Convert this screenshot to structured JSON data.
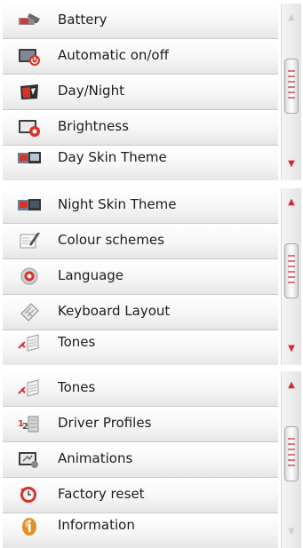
{
  "panels": [
    {
      "items": [
        {
          "label": "Battery",
          "icon": "battery-icon"
        },
        {
          "label": "Automatic on/off",
          "icon": "automatic-power-icon"
        },
        {
          "label": "Day/Night",
          "icon": "day-night-icon"
        },
        {
          "label": "Brightness",
          "icon": "brightness-icon"
        },
        {
          "label": "Day Skin Theme",
          "icon": "day-skin-theme-icon"
        }
      ],
      "scroll": {
        "up_enabled": false,
        "down_enabled": true,
        "up_glyph": "▲",
        "down_glyph": "▼"
      }
    },
    {
      "items": [
        {
          "label": "Night Skin Theme",
          "icon": "night-skin-theme-icon"
        },
        {
          "label": "Colour schemes",
          "icon": "colour-schemes-icon"
        },
        {
          "label": "Language",
          "icon": "language-icon"
        },
        {
          "label": "Keyboard Layout",
          "icon": "keyboard-layout-icon"
        },
        {
          "label": "Tones",
          "icon": "tones-icon"
        }
      ],
      "scroll": {
        "up_enabled": true,
        "down_enabled": true,
        "up_glyph": "▲",
        "down_glyph": "▼"
      }
    },
    {
      "items": [
        {
          "label": "Tones",
          "icon": "tones-icon"
        },
        {
          "label": "Driver Profiles",
          "icon": "driver-profiles-icon"
        },
        {
          "label": "Animations",
          "icon": "animations-icon"
        },
        {
          "label": "Factory reset",
          "icon": "factory-reset-icon"
        },
        {
          "label": "Information",
          "icon": "information-icon"
        }
      ],
      "scroll": {
        "up_enabled": true,
        "down_enabled": false,
        "up_glyph": "▲",
        "down_glyph": "▼"
      }
    }
  ],
  "colors": {
    "accent": "#d42a2a",
    "row_text": "#1c1c1c",
    "divider": "#c9c9c9"
  }
}
